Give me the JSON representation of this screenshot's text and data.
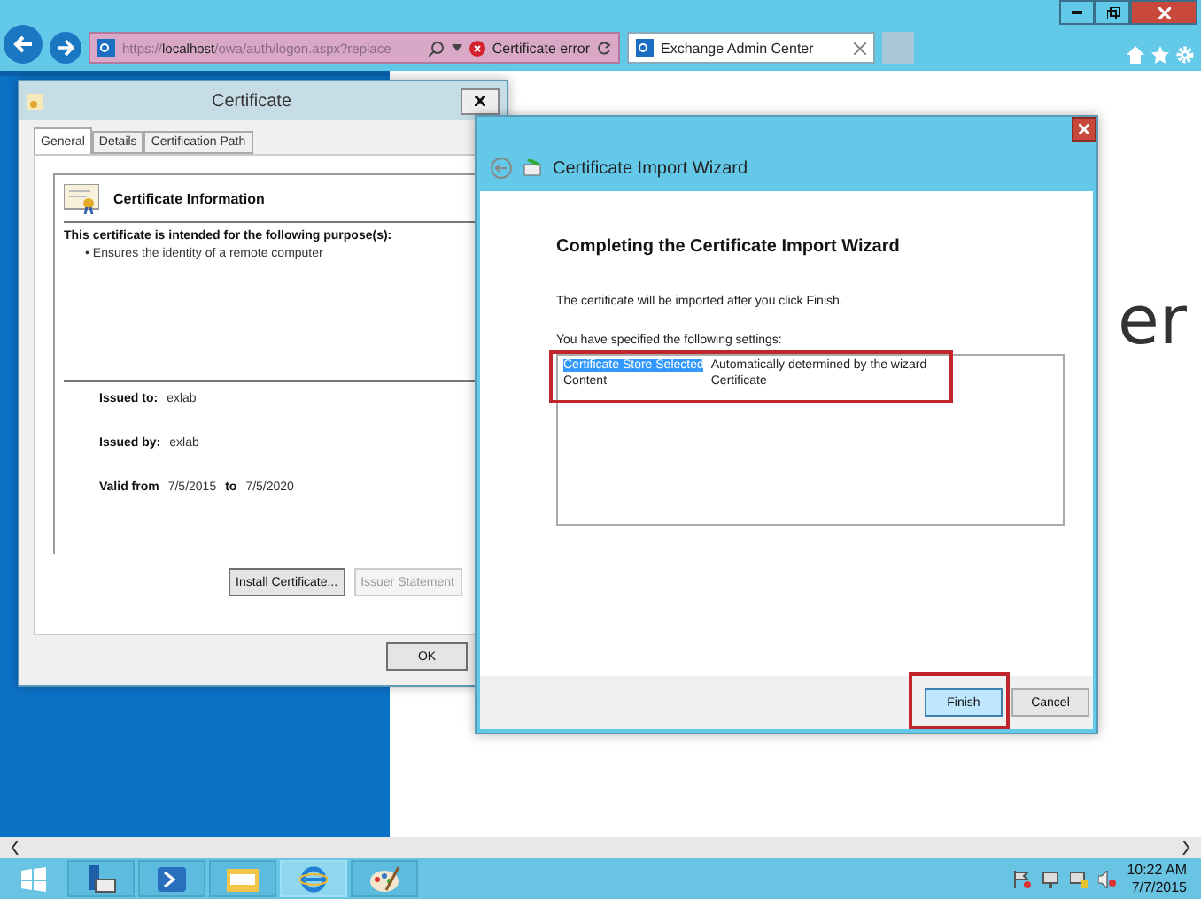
{
  "browser": {
    "address": "https://**localhost**/owa/auth/logon.aspx?replace",
    "security_status": "Certificate error",
    "tabs": [
      {
        "label": "Exchange Admin Center",
        "selected": true
      }
    ]
  },
  "page": {
    "heading_fragment": "er"
  },
  "certificate_dialog": {
    "title": "Certificate",
    "tabs": [
      {
        "label": "General",
        "selected": true
      },
      {
        "label": "Details",
        "selected": false
      },
      {
        "label": "Certification Path",
        "selected": false
      }
    ],
    "info_title": "Certificate Information",
    "purpose_heading": "This certificate is intended for the following purpose(s):",
    "purposes": [
      "• Ensures the identity of a remote computer"
    ],
    "fields": [
      {
        "label": "Issued to:",
        "value": "exlab"
      },
      {
        "label": "Issued by:",
        "value": "exlab"
      }
    ],
    "validity": {
      "from_label": "Valid from",
      "from": "7/5/2015",
      "to_label": "to",
      "to": "7/5/2020"
    },
    "buttons": [
      {
        "label": "Install Certificate...",
        "disabled": false
      },
      {
        "label": "Issuer Statement",
        "disabled": true
      }
    ],
    "ok": "OK"
  },
  "wizard": {
    "title": "Certificate Import Wizard",
    "heading": "Completing the Certificate Import Wizard",
    "message": "The certificate will be imported after you click Finish.",
    "settings_label": "You have specified the following settings:",
    "settings_highlighted": true,
    "settings": [
      {
        "name": "Certificate Store Selected",
        "value": "Automatically determined by the wizard",
        "selected": true
      },
      {
        "name": "Content",
        "value": "Certificate",
        "selected": false
      }
    ],
    "buttons": [
      {
        "label": "Finish",
        "default": true,
        "highlighted": true
      },
      {
        "label": "Cancel",
        "default": false,
        "highlighted": false
      }
    ]
  },
  "taskbar": {
    "apps": [
      {
        "kind": "server-manager",
        "active": false
      },
      {
        "kind": "powershell",
        "active": false
      },
      {
        "kind": "explorer",
        "active": false
      },
      {
        "kind": "ie",
        "active": true
      },
      {
        "kind": "paint",
        "active": false
      }
    ],
    "time": "10:22 AM",
    "date": "7/7/2015"
  }
}
